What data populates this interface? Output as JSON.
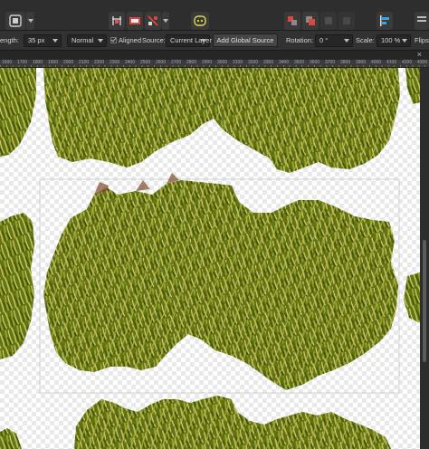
{
  "toolbar": {
    "icons": [
      "selection-mode-icon",
      "snapping-icon",
      "assistant-icon",
      "arrange-icon",
      "align-icon"
    ]
  },
  "context": {
    "length_label": "ength:",
    "width_value": "35 px",
    "blend_mode": "Normal",
    "aligned_label": "Aligned",
    "source_label": "Source:",
    "source_value": "Current Layer",
    "add_global_source": "Add Global Source",
    "rotation_label": "Rotation:",
    "rotation_value": "0 °",
    "scale_label": "Scale:",
    "scale_value": "100 %",
    "flips_label": "Flips:"
  },
  "tab": {
    "close": "×"
  },
  "ruler": {
    "labels": [
      "1600",
      "1700",
      "1800",
      "1900",
      "2000",
      "2100",
      "2200",
      "2300",
      "2400",
      "2500",
      "2600",
      "2700",
      "2800",
      "2900",
      "3000",
      "3100",
      "3200",
      "3300",
      "3400",
      "3500",
      "3600",
      "3700",
      "3800",
      "3900",
      "4000",
      "4100",
      "4200",
      "4300"
    ]
  },
  "colors": {
    "grass_dark": "#4a5a12",
    "grass_mid": "#7d8f1f",
    "grass_light": "#c6c35a",
    "checker": "#e9e9e9",
    "ui_bg": "#2e2e2e"
  }
}
